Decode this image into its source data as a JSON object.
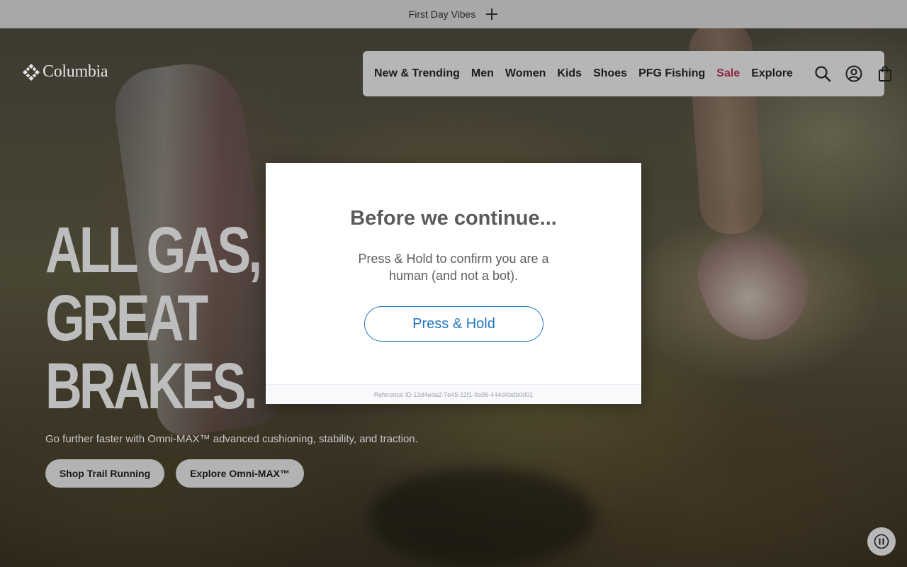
{
  "promo": {
    "text": "First Day Vibes"
  },
  "brand": {
    "name": "Columbia"
  },
  "nav": {
    "items": [
      {
        "label": "New & Trending",
        "name": "nav-item-new-trending"
      },
      {
        "label": "Men",
        "name": "nav-item-men"
      },
      {
        "label": "Women",
        "name": "nav-item-women"
      },
      {
        "label": "Kids",
        "name": "nav-item-kids"
      },
      {
        "label": "Shoes",
        "name": "nav-item-shoes"
      },
      {
        "label": "PFG Fishing",
        "name": "nav-item-pfg-fishing"
      },
      {
        "label": "Sale",
        "name": "nav-item-sale"
      },
      {
        "label": "Explore",
        "name": "nav-item-explore"
      }
    ],
    "icons": [
      "search-icon",
      "account-icon",
      "shopping-bag-icon"
    ]
  },
  "hero": {
    "headline": [
      "ALL GAS,",
      "GREAT",
      "BRAKES."
    ],
    "subtext": "Go further faster with Omni-MAX™ advanced cushioning, stability, and traction.",
    "buttons": [
      "Shop Trail Running",
      "Explore Omni-MAX™"
    ]
  },
  "modal": {
    "title": "Before we continue...",
    "text": "Press & Hold to confirm you are a human (and not a bot).",
    "button": "Press & Hold",
    "reference": "Reference ID 13d4eda2-7e45-11f1-9a96-444d4bdb0d01"
  },
  "colors": {
    "sale": "#8b2944",
    "modal_accent": "#2176c3"
  }
}
